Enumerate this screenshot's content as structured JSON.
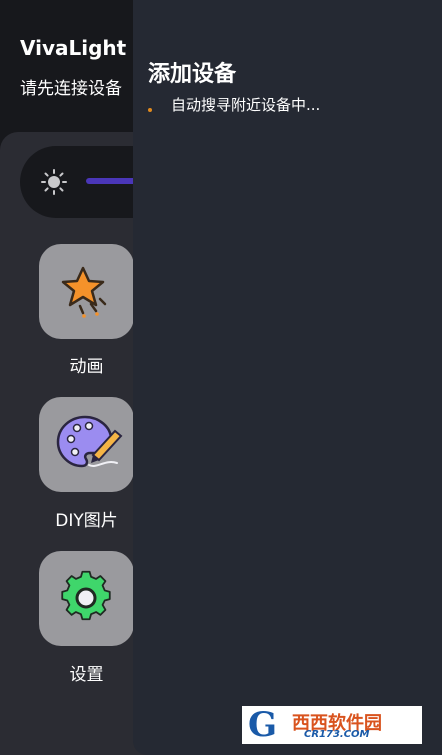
{
  "app": {
    "title": "VivaLight",
    "subtitle": "请先连接设备",
    "brightness_icon": "sun-icon"
  },
  "menu": [
    {
      "label": "动画",
      "icon": "star-icon"
    },
    {
      "label": "DIY图片",
      "icon": "palette-icon"
    },
    {
      "label": "设置",
      "icon": "gear-icon"
    }
  ],
  "drawer": {
    "title": "添加设备",
    "status": "自动搜寻附近设备中..."
  },
  "watermark": {
    "name": "西西软件园",
    "url": "CR173.COM"
  },
  "colors": {
    "background": "#17181c",
    "panel": "#2b2c33",
    "drawer": "#252933",
    "slider": "#4a36b8",
    "tile": "#9a9a9e",
    "accent_orange": "#f5922a",
    "accent_green": "#3fd66b"
  }
}
